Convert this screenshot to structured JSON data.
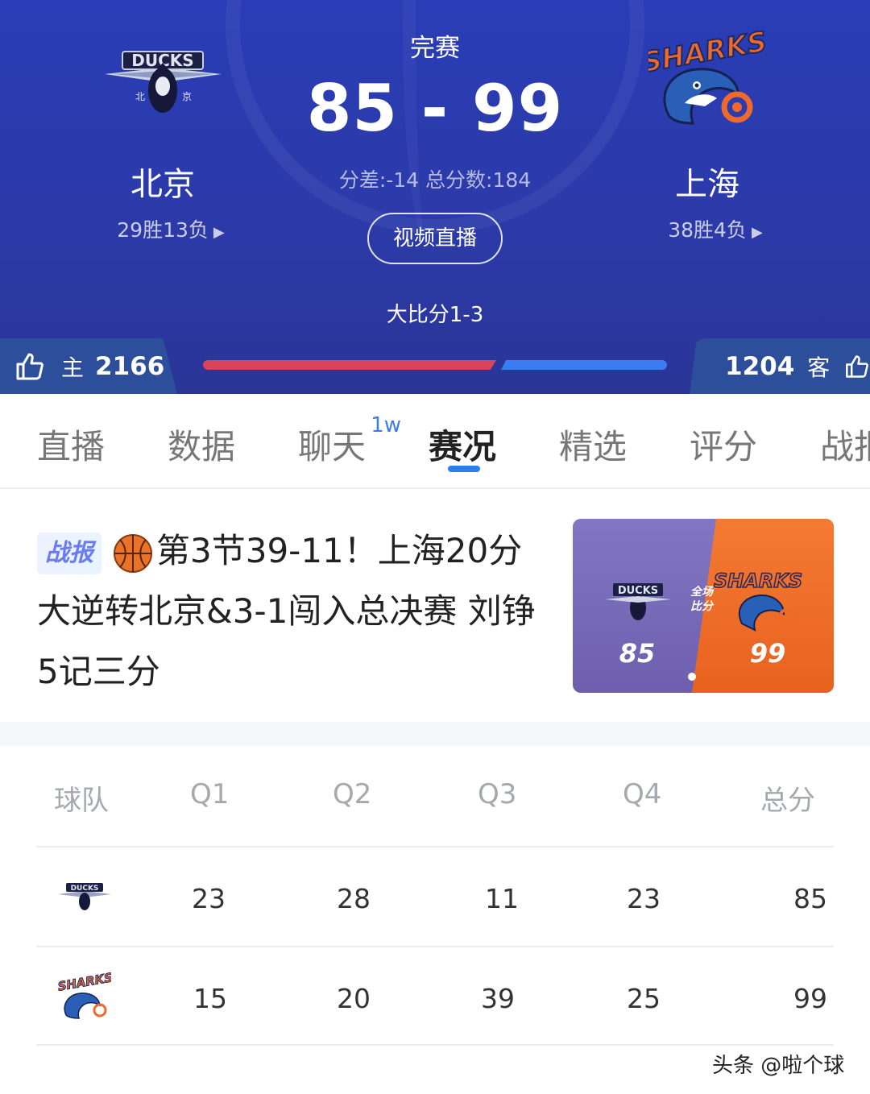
{
  "game": {
    "status": "完赛",
    "score": "85 - 99",
    "summary": "分差:-14 总分数:184",
    "live_button": "视频直播",
    "series": "大比分1-3"
  },
  "home": {
    "name": "北京",
    "record": "29胜13负",
    "logo_icon": "ducks-logo-icon",
    "likes_label": "主",
    "likes": "2166"
  },
  "away": {
    "name": "上海",
    "record": "38胜4负",
    "logo_icon": "sharks-logo-icon",
    "likes_label": "客",
    "likes": "1204"
  },
  "tabs": [
    {
      "label": "直播"
    },
    {
      "label": "数据"
    },
    {
      "label": "聊天",
      "badge": "1w"
    },
    {
      "label": "赛况",
      "active": true
    },
    {
      "label": "精选"
    },
    {
      "label": "评分"
    },
    {
      "label": "战报"
    }
  ],
  "news": {
    "badge": "战报",
    "title": "第3节39-11！上海20分大逆转北京&3-1闯入总决赛 刘铮5记三分",
    "thumb": {
      "home_score": "85",
      "away_score": "99",
      "center_label_1": "全场",
      "center_label_2": "比分"
    }
  },
  "score_table": {
    "headers": [
      "球队",
      "Q1",
      "Q2",
      "Q3",
      "Q4",
      "总分"
    ],
    "rows": [
      {
        "team_icon": "ducks-logo-icon",
        "q1": "23",
        "q2": "28",
        "q3": "11",
        "q4": "23",
        "total": "85"
      },
      {
        "team_icon": "sharks-logo-icon",
        "q1": "15",
        "q2": "20",
        "q3": "39",
        "q4": "25",
        "total": "99"
      }
    ]
  },
  "watermark": "头条 @啦个球",
  "colors": {
    "header_bg": "#2c3aa8",
    "home_bar": "#d9445a",
    "away_bar": "#3c7ef2",
    "tab_accent": "#2f7fe8"
  }
}
